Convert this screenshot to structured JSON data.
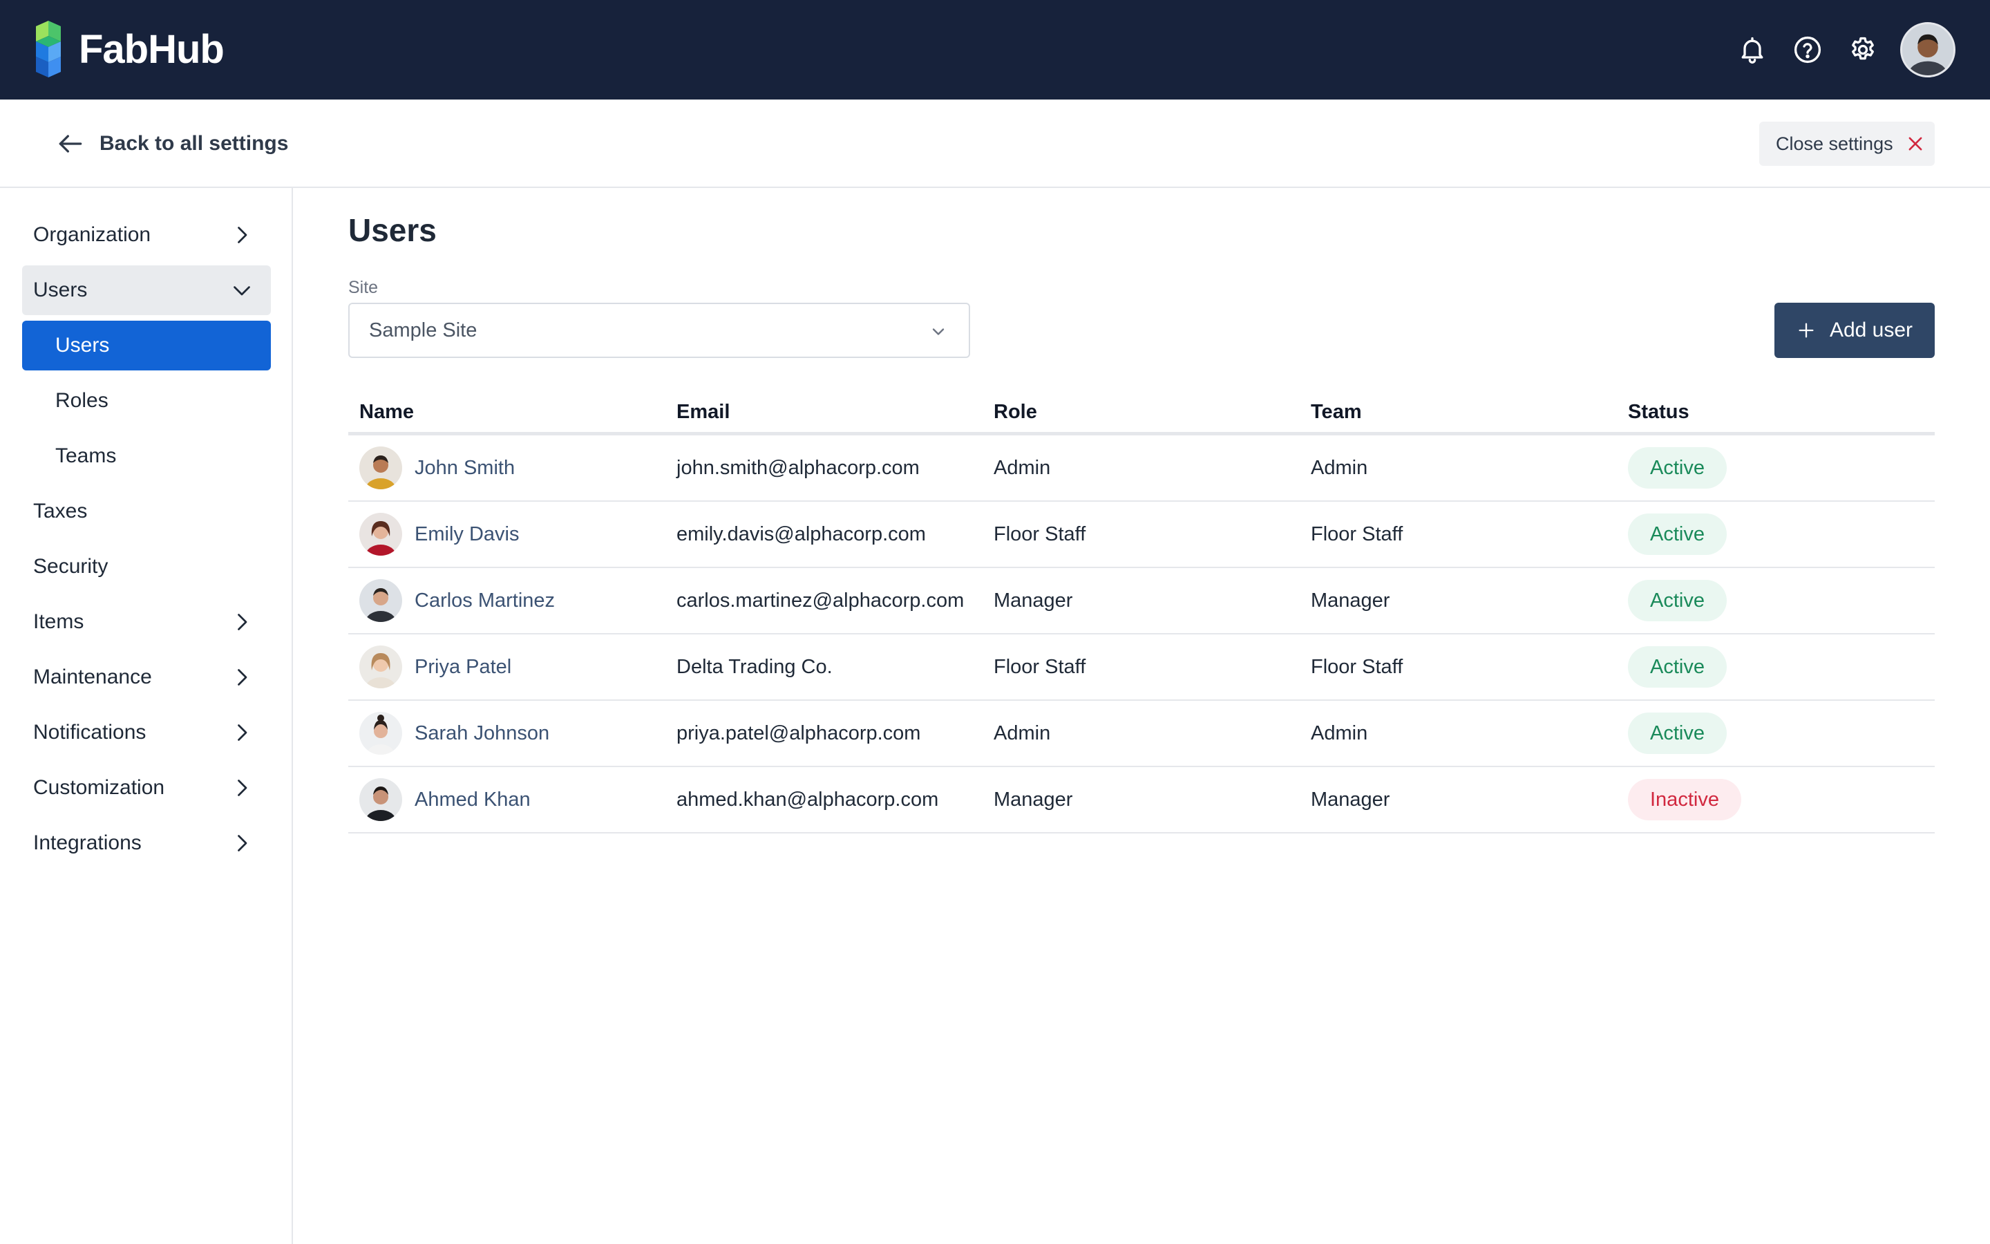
{
  "app": {
    "name": "FabHub"
  },
  "colors": {
    "topbar_bg": "#17223b",
    "accent_blue": "#1264d6",
    "primary_button": "#2f4666",
    "active_green": "#1a8a5a",
    "inactive_red": "#d1283f"
  },
  "topbar": {
    "icons": [
      "bell-icon",
      "help-icon",
      "gear-icon"
    ],
    "avatar": "user-avatar"
  },
  "subheader": {
    "back_label": "Back to all settings",
    "close_label": "Close settings"
  },
  "sidebar": {
    "items": [
      {
        "label": "Organization",
        "chevron": "right"
      },
      {
        "label": "Users",
        "chevron": "down",
        "expanded": true
      },
      {
        "label": "Users",
        "sub": true,
        "selected": true
      },
      {
        "label": "Roles",
        "sub": true
      },
      {
        "label": "Teams",
        "sub": true
      },
      {
        "label": "Taxes"
      },
      {
        "label": "Security"
      },
      {
        "label": "Items",
        "chevron": "right"
      },
      {
        "label": "Maintenance",
        "chevron": "right"
      },
      {
        "label": "Notifications",
        "chevron": "right"
      },
      {
        "label": "Customization",
        "chevron": "right"
      },
      {
        "label": "Integrations",
        "chevron": "right"
      }
    ]
  },
  "main": {
    "title": "Users",
    "site_filter": {
      "label": "Site",
      "value": "Sample Site"
    },
    "add_button_label": "Add user",
    "table": {
      "columns": [
        "Name",
        "Email",
        "Role",
        "Team",
        "Status"
      ],
      "rows": [
        {
          "name": "John Smith",
          "email": "john.smith@alphacorp.com",
          "role": "Admin",
          "team": "Admin",
          "status": "Active"
        },
        {
          "name": "Emily Davis",
          "email": "emily.davis@alphacorp.com",
          "role": "Floor Staff",
          "team": "Floor Staff",
          "status": "Active"
        },
        {
          "name": "Carlos Martinez",
          "email": "carlos.martinez@alphacorp.com",
          "role": "Manager",
          "team": "Manager",
          "status": "Active"
        },
        {
          "name": "Priya Patel",
          "email": "Delta Trading Co.",
          "role": "Floor Staff",
          "team": "Floor Staff",
          "status": "Active"
        },
        {
          "name": "Sarah Johnson",
          "email": "priya.patel@alphacorp.com",
          "role": "Admin",
          "team": "Admin",
          "status": "Active"
        },
        {
          "name": "Ahmed Khan",
          "email": "ahmed.khan@alphacorp.com",
          "role": "Manager",
          "team": "Manager",
          "status": "Inactive"
        }
      ]
    }
  }
}
